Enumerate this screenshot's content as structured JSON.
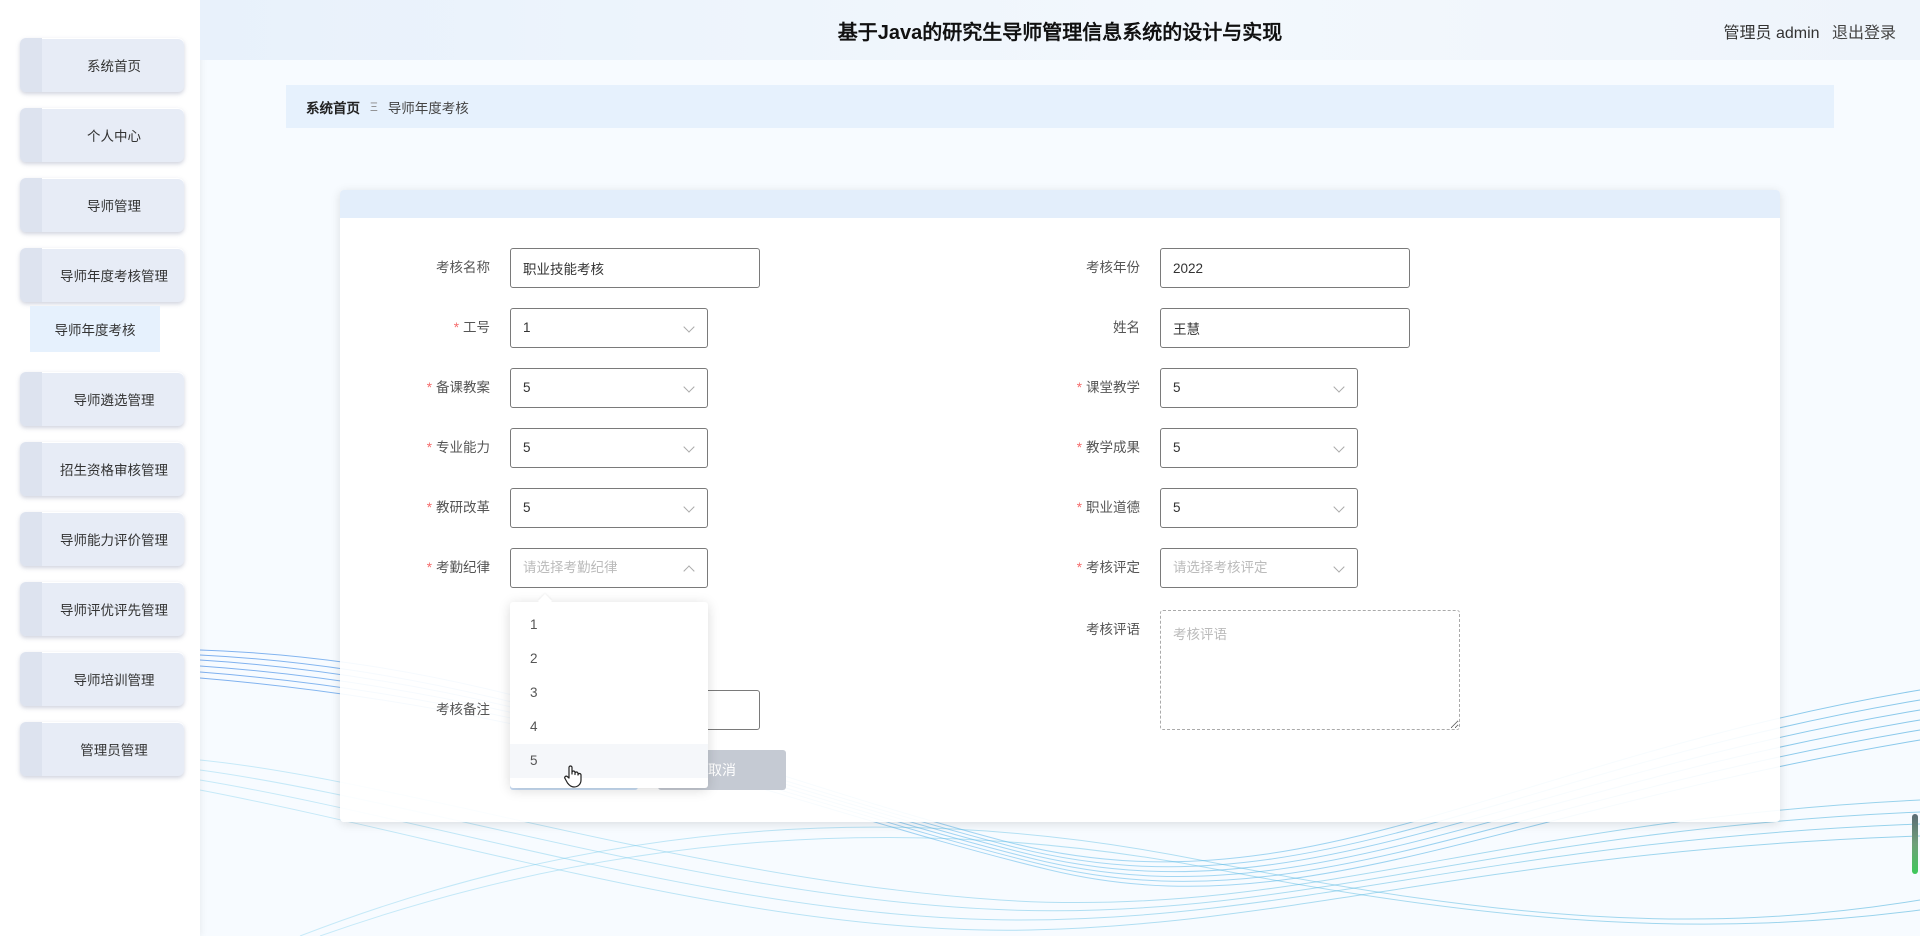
{
  "app": {
    "title": "基于Java的研究生导师管理信息系统的设计与实现",
    "user_label": "管理员 admin",
    "logout_label": "退出登录"
  },
  "sidebar": {
    "items": [
      {
        "label": "系统首页"
      },
      {
        "label": "个人中心"
      },
      {
        "label": "导师管理"
      },
      {
        "label": "导师年度考核管理"
      },
      {
        "label": "导师遴选管理"
      },
      {
        "label": "招生资格审核管理"
      },
      {
        "label": "导师能力评价管理"
      },
      {
        "label": "导师评优评先管理"
      },
      {
        "label": "导师培训管理"
      },
      {
        "label": "管理员管理"
      }
    ],
    "sub_item": {
      "label": "导师年度考核"
    }
  },
  "breadcrumb": {
    "home": "系统首页",
    "separator": "Ξ",
    "current": "导师年度考核"
  },
  "form": {
    "assess_name": {
      "label": "考核名称",
      "value": "职业技能考核"
    },
    "assess_year": {
      "label": "考核年份",
      "value": "2022"
    },
    "job_no": {
      "label": "工号",
      "value": "1"
    },
    "name": {
      "label": "姓名",
      "value": "王慧"
    },
    "lesson_prep": {
      "label": "备课教案",
      "value": "5"
    },
    "classroom": {
      "label": "课堂教学",
      "value": "5"
    },
    "professional": {
      "label": "专业能力",
      "value": "5"
    },
    "teaching_result": {
      "label": "教学成果",
      "value": "5"
    },
    "research_reform": {
      "label": "教研改革",
      "value": "5"
    },
    "ethics": {
      "label": "职业道德",
      "value": "5"
    },
    "attendance": {
      "label": "考勤纪律",
      "placeholder": "请选择考勤纪律"
    },
    "assess_rating": {
      "label": "考核评定",
      "placeholder": "请选择考核评定"
    },
    "comment": {
      "label": "考核评语",
      "placeholder": "考核评语"
    },
    "remark": {
      "label": "考核备注"
    },
    "required_mark": "*",
    "cancel_label": "取消"
  },
  "dropdown": {
    "options": [
      "1",
      "2",
      "3",
      "4",
      "5"
    ]
  }
}
